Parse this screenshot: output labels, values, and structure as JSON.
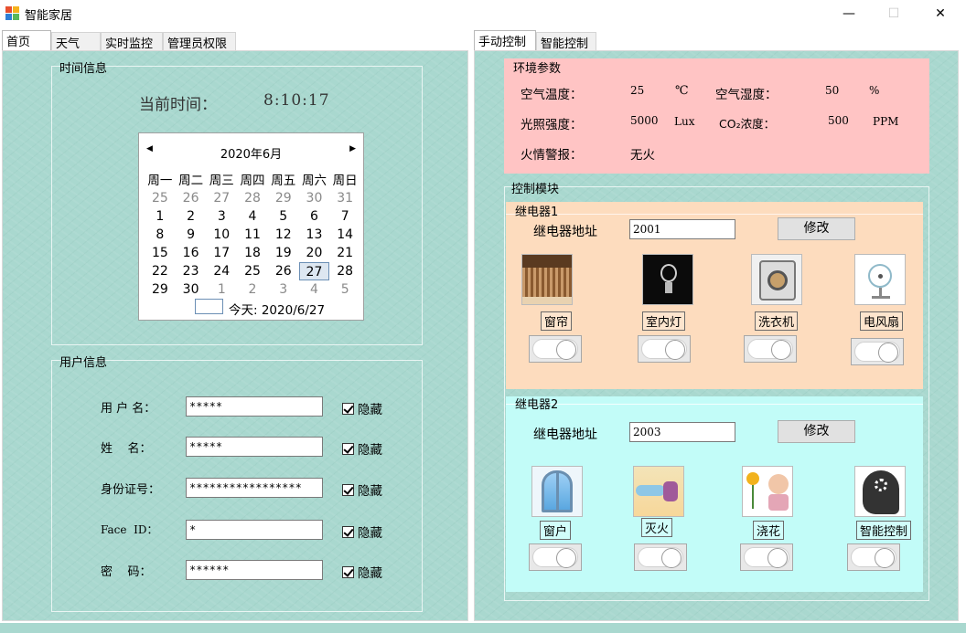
{
  "window": {
    "title": "智能家居",
    "minimize_glyph": "—",
    "maximize_glyph": "☐",
    "close_glyph": "✕"
  },
  "left_tabs": [
    {
      "label": "首页",
      "active": true
    },
    {
      "label": "天气",
      "active": false
    },
    {
      "label": "实时监控",
      "active": false
    },
    {
      "label": "管理员权限",
      "active": false
    }
  ],
  "right_tabs": [
    {
      "label": "手动控制",
      "active": true
    },
    {
      "label": "智能控制",
      "active": false
    }
  ],
  "time_info": {
    "group_title": "时间信息",
    "label": "当前时间：",
    "value": "8:10:17"
  },
  "calendar": {
    "month_title": "2020年6月",
    "prev_glyph": "◀",
    "next_glyph": "▶",
    "weekdays": [
      "周一",
      "周二",
      "周三",
      "周四",
      "周五",
      "周六",
      "周日"
    ],
    "weeks": [
      [
        "25",
        "26",
        "27",
        "28",
        "29",
        "30",
        "31"
      ],
      [
        "1",
        "2",
        "3",
        "4",
        "5",
        "6",
        "7"
      ],
      [
        "8",
        "9",
        "10",
        "11",
        "12",
        "13",
        "14"
      ],
      [
        "15",
        "16",
        "17",
        "18",
        "19",
        "20",
        "21"
      ],
      [
        "22",
        "23",
        "24",
        "25",
        "26",
        "27",
        "28"
      ],
      [
        "29",
        "30",
        "1",
        "2",
        "3",
        "4",
        "5"
      ]
    ],
    "selected": "27",
    "today_text": "今天: 2020/6/27"
  },
  "user_info": {
    "group_title": "用户信息",
    "fields": [
      {
        "label": "用 户 名：",
        "value": "*****",
        "checkbox": "隐藏"
      },
      {
        "label": "姓    名：",
        "value": "*****",
        "checkbox": "隐藏"
      },
      {
        "label": "身份证号：",
        "value": "*****************",
        "checkbox": "隐藏"
      },
      {
        "label": "Face  ID：",
        "value": "*",
        "checkbox": "隐藏"
      },
      {
        "label": "密    码：",
        "value": "******",
        "checkbox": "隐藏"
      }
    ]
  },
  "environment": {
    "group_title": "环境参数",
    "air_temp_label": "空气温度：",
    "air_temp_value": "25",
    "air_temp_unit": "℃",
    "air_humidity_label": "空气湿度：",
    "air_humidity_value": "50",
    "air_humidity_unit": "%",
    "light_label": "光照强度：",
    "light_value": "5000",
    "light_unit": "Lux",
    "co2_label": "CO₂浓度：",
    "co2_value": "500",
    "co2_unit": "PPM",
    "fire_label": "火情警报：",
    "fire_value": "无火"
  },
  "control": {
    "group_title": "控制模块",
    "relay1": {
      "title": "继电器1",
      "address_label": "继电器地址",
      "address_value": "2001",
      "modify_label": "修改",
      "devices": [
        {
          "name": "窗帘",
          "icon": "curtain-icon",
          "on": false
        },
        {
          "name": "室内灯",
          "icon": "lightbulb-icon",
          "on": false
        },
        {
          "name": "洗衣机",
          "icon": "washing-machine-icon",
          "on": false
        },
        {
          "name": "电风扇",
          "icon": "fan-icon",
          "on": false
        }
      ]
    },
    "relay2": {
      "title": "继电器2",
      "address_label": "继电器地址",
      "address_value": "2003",
      "modify_label": "修改",
      "devices": [
        {
          "name": "窗户",
          "icon": "window-icon",
          "on": false
        },
        {
          "name": "灭火",
          "icon": "fire-extinguish-icon",
          "on": false
        },
        {
          "name": "浇花",
          "icon": "watering-flowers-icon",
          "on": false
        },
        {
          "name": "智能控制",
          "icon": "smart-head-icon",
          "on": false
        }
      ]
    }
  },
  "colors": {
    "teal_bg": "#a9d8cf",
    "env_pink": "#ffc4c4",
    "relay1_peach": "#fddcbe",
    "relay2_cyan": "#c2fcf8"
  }
}
